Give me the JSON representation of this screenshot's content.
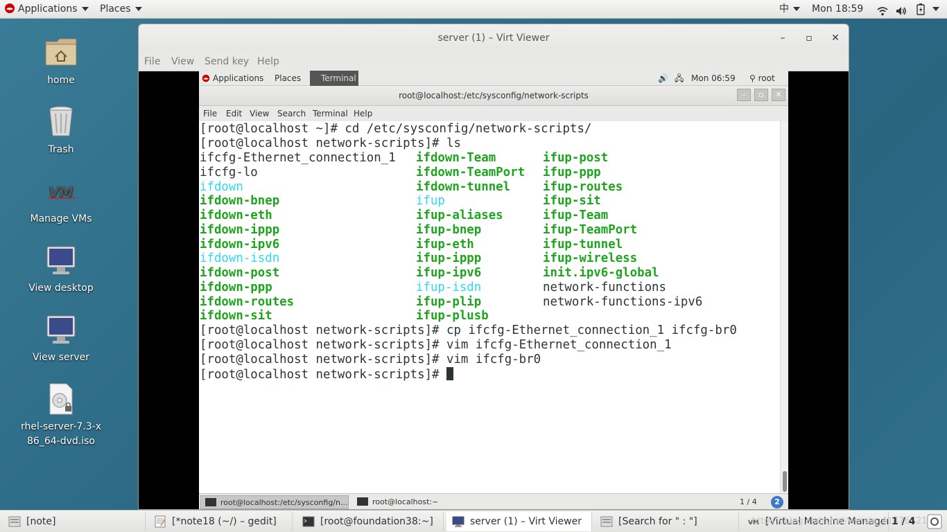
{
  "host_topbar": {
    "applications": "Applications",
    "places": "Places",
    "input_method": "中",
    "clock": "Mon 18:59"
  },
  "desktop_icons": [
    {
      "label": "home",
      "icon": "home-folder-icon"
    },
    {
      "label": "Trash",
      "icon": "trash-icon"
    },
    {
      "label": "Manage VMs",
      "icon": "vm-manager-icon"
    },
    {
      "label": "View desktop",
      "icon": "monitor-icon"
    },
    {
      "label": "View server",
      "icon": "monitor-icon"
    },
    {
      "label": "rhel-server-7.3-x86_64-dvd.iso",
      "icon": "disc-image-icon"
    }
  ],
  "virt_viewer": {
    "title": "server (1) – Virt Viewer",
    "menu": [
      "File",
      "View",
      "Send key",
      "Help"
    ]
  },
  "guest_topbar": {
    "applications": "Applications",
    "places": "Places",
    "terminal_tab": "Terminal",
    "clock": "Mon 06:59",
    "user": "root"
  },
  "terminal": {
    "title": "root@localhost:/etc/sysconfig/network-scripts",
    "menu": [
      "File",
      "Edit",
      "View",
      "Search",
      "Terminal",
      "Help"
    ],
    "lines_top": [
      "[root@localhost ~]# cd /etc/sysconfig/network-scripts/",
      "[root@localhost network-scripts]# ls"
    ],
    "ls_columns": [
      [
        {
          "t": "ifcfg-Ethernet_connection_1",
          "c": "w"
        },
        {
          "t": "ifcfg-lo",
          "c": "w"
        },
        {
          "t": "ifdown",
          "c": "c"
        },
        {
          "t": "ifdown-bnep",
          "c": "g"
        },
        {
          "t": "ifdown-eth",
          "c": "g"
        },
        {
          "t": "ifdown-ippp",
          "c": "g"
        },
        {
          "t": "ifdown-ipv6",
          "c": "g"
        },
        {
          "t": "ifdown-isdn",
          "c": "c"
        },
        {
          "t": "ifdown-post",
          "c": "g"
        },
        {
          "t": "ifdown-ppp",
          "c": "g"
        },
        {
          "t": "ifdown-routes",
          "c": "g"
        },
        {
          "t": "ifdown-sit",
          "c": "g"
        }
      ],
      [
        {
          "t": "ifdown-Team",
          "c": "g"
        },
        {
          "t": "ifdown-TeamPort",
          "c": "g"
        },
        {
          "t": "ifdown-tunnel",
          "c": "g"
        },
        {
          "t": "ifup",
          "c": "c"
        },
        {
          "t": "ifup-aliases",
          "c": "g"
        },
        {
          "t": "ifup-bnep",
          "c": "g"
        },
        {
          "t": "ifup-eth",
          "c": "g"
        },
        {
          "t": "ifup-ippp",
          "c": "g"
        },
        {
          "t": "ifup-ipv6",
          "c": "g"
        },
        {
          "t": "ifup-isdn",
          "c": "c"
        },
        {
          "t": "ifup-plip",
          "c": "g"
        },
        {
          "t": "ifup-plusb",
          "c": "g"
        }
      ],
      [
        {
          "t": "ifup-post",
          "c": "g"
        },
        {
          "t": "ifup-ppp",
          "c": "g"
        },
        {
          "t": "ifup-routes",
          "c": "g"
        },
        {
          "t": "ifup-sit",
          "c": "g"
        },
        {
          "t": "ifup-Team",
          "c": "g"
        },
        {
          "t": "ifup-TeamPort",
          "c": "g"
        },
        {
          "t": "ifup-tunnel",
          "c": "g"
        },
        {
          "t": "ifup-wireless",
          "c": "g"
        },
        {
          "t": "init.ipv6-global",
          "c": "g"
        },
        {
          "t": "network-functions",
          "c": "w"
        },
        {
          "t": "network-functions-ipv6",
          "c": "w"
        }
      ]
    ],
    "lines_bottom": [
      "[root@localhost network-scripts]# cp ifcfg-Ethernet_connection_1 ifcfg-br0",
      "[root@localhost network-scripts]# vim ifcfg-Ethernet_connection_1",
      "[root@localhost network-scripts]# vim ifcfg-br0",
      "[root@localhost network-scripts]# "
    ]
  },
  "guest_taskbar": {
    "items": [
      "root@localhost:/etc/sysconfig/n...",
      "root@localhost:~"
    ],
    "pager": "1 / 4",
    "notifications": "2"
  },
  "host_taskbar": {
    "items": [
      {
        "label": "[note]",
        "icon": "files-icon",
        "active": false
      },
      {
        "label": "[*note18 (~/) – gedit]",
        "icon": "text-editor-icon",
        "active": false
      },
      {
        "label": "[root@foundation38:~]",
        "icon": "terminal-icon",
        "active": false
      },
      {
        "label": "server (1) – Virt Viewer",
        "icon": "virt-viewer-icon",
        "active": true
      },
      {
        "label": "[Search for \" : \"]",
        "icon": "files-icon",
        "active": false
      },
      {
        "label": "[Virtual Machine Manager]",
        "icon": "vm-manager-icon",
        "active": false
      }
    ],
    "pager": "1 / 4",
    "watermark": "https://blog.csdn.net/weixin_41476521"
  },
  "colors": {
    "ls_green": "#1ea51e",
    "ls_cyan": "#2ed8f0",
    "desktop": "#2e6a86"
  }
}
